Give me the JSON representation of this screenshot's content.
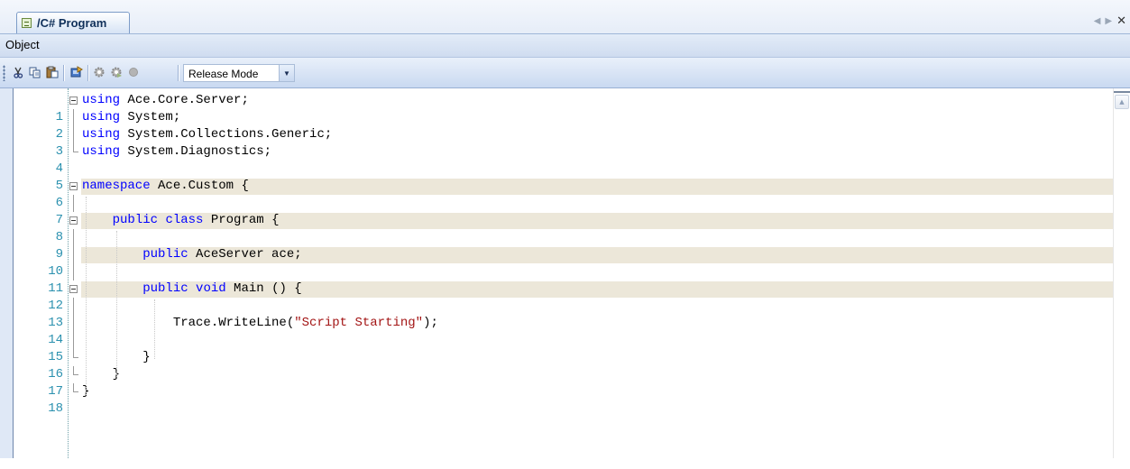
{
  "tab": {
    "title": "/C# Program"
  },
  "menu": {
    "items": [
      "Object"
    ]
  },
  "toolbar": {
    "icons": [
      "cut-icon",
      "copy-icon",
      "paste-icon",
      "deploy-icon",
      "settings-icon",
      "settings-run-icon",
      "stop-icon"
    ],
    "mode_value": "Release Mode"
  },
  "editor": {
    "lines": [
      {
        "n": "1",
        "code": "using Ace.Core.Server;"
      },
      {
        "n": "2",
        "code": "using System;"
      },
      {
        "n": "3",
        "code": "using System.Collections.Generic;"
      },
      {
        "n": "4",
        "code": "using System.Diagnostics;"
      },
      {
        "n": "5",
        "code": ""
      },
      {
        "n": "6",
        "code": "namespace Ace.Custom {"
      },
      {
        "n": "7",
        "code": ""
      },
      {
        "n": "8",
        "code": "    public class Program {"
      },
      {
        "n": "9",
        "code": ""
      },
      {
        "n": "10",
        "code": "        public AceServer ace;"
      },
      {
        "n": "11",
        "code": ""
      },
      {
        "n": "12",
        "code": "        public void Main () {"
      },
      {
        "n": "13",
        "code": ""
      },
      {
        "n": "14",
        "code": "            Trace.WriteLine(\"Script Starting\");"
      },
      {
        "n": "15",
        "code": ""
      },
      {
        "n": "16",
        "code": "        }"
      },
      {
        "n": "17",
        "code": "    }"
      },
      {
        "n": "18",
        "code": "}"
      }
    ]
  }
}
